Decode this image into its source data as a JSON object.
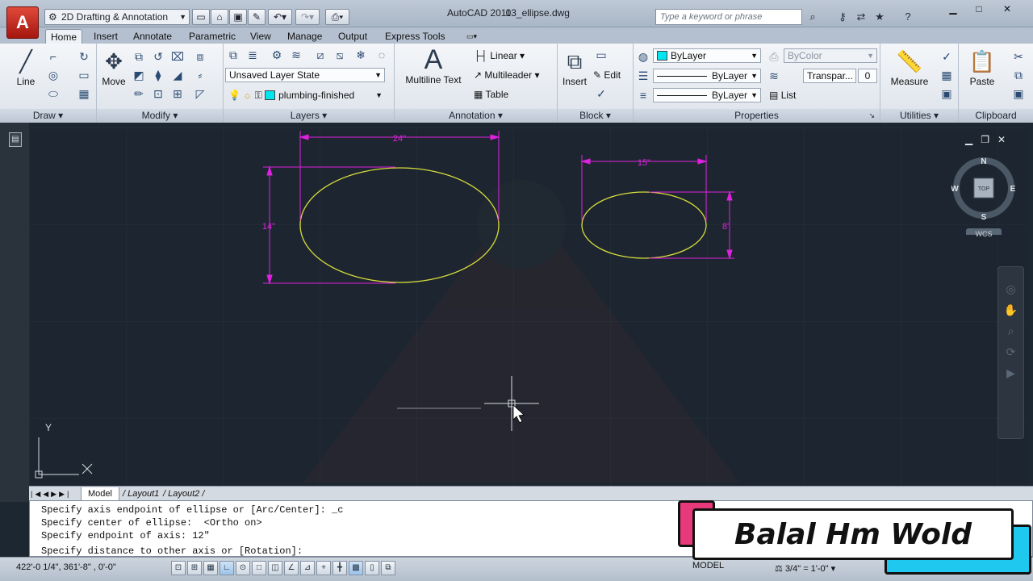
{
  "app": {
    "app_button": "A",
    "workspace": "2D Drafting & Annotation",
    "window_title": "AutoCAD 2011",
    "file_name": "03_ellipse.dwg",
    "search_placeholder": "Type a keyword or phrase"
  },
  "tabs": [
    "Home",
    "Insert",
    "Annotate",
    "Parametric",
    "View",
    "Manage",
    "Output",
    "Express Tools"
  ],
  "ribbon": {
    "draw": {
      "label": "Draw",
      "line": "Line"
    },
    "modify": {
      "label": "Modify",
      "move": "Move"
    },
    "layers": {
      "label": "Layers",
      "layer_state": "Unsaved Layer State",
      "current_layer": "plumbing-finished",
      "layer_color": "#00e5ee"
    },
    "annotation": {
      "label": "Annotation",
      "multiline_text": "Multiline Text",
      "linear": "Linear",
      "multileader": "Multileader",
      "table": "Table"
    },
    "block": {
      "label": "Block",
      "insert": "Insert",
      "edit": "Edit"
    },
    "properties": {
      "label": "Properties",
      "color": "ByLayer",
      "linetype": "ByLayer",
      "lineweight": "ByLayer",
      "plot_style": "ByColor",
      "transparency_label": "Transpar...",
      "transparency_value": "0",
      "list": "List",
      "color_swatch": "#00e5ee"
    },
    "utilities": {
      "label": "Utilities",
      "measure": "Measure"
    },
    "clipboard": {
      "label": "Clipboard",
      "paste": "Paste"
    }
  },
  "drawing": {
    "ellipse1": {
      "width_dim": "24\"",
      "height_dim": "14\""
    },
    "ellipse2": {
      "width_dim": "15\"",
      "height_dim": "8\""
    },
    "ucs_y": "Y",
    "viewcube": {
      "n": "N",
      "s": "S",
      "e": "E",
      "w": "W",
      "face": "TOP",
      "wcs": "WCS"
    },
    "colors": {
      "ellipse": "#d8dc3c",
      "dimension": "#e020e0",
      "background": "#1d2630"
    }
  },
  "layout_tabs": [
    "Model",
    "Layout1",
    "Layout2"
  ],
  "command_history": [
    "Specify axis endpoint of ellipse or [Arc/Center]: _c",
    "Specify center of ellipse:  <Ortho on>",
    "Specify endpoint of axis: 12\"",
    "Specify distance to other axis or [Rotation]:"
  ],
  "status": {
    "coordinates": "422'-0 1/4\",  361'-8\"  , 0'-0\"",
    "model": "MODEL",
    "annotation_scale": "3/4\" = 1'-0\""
  },
  "overlay": {
    "name": "Balal Hm Wold"
  }
}
